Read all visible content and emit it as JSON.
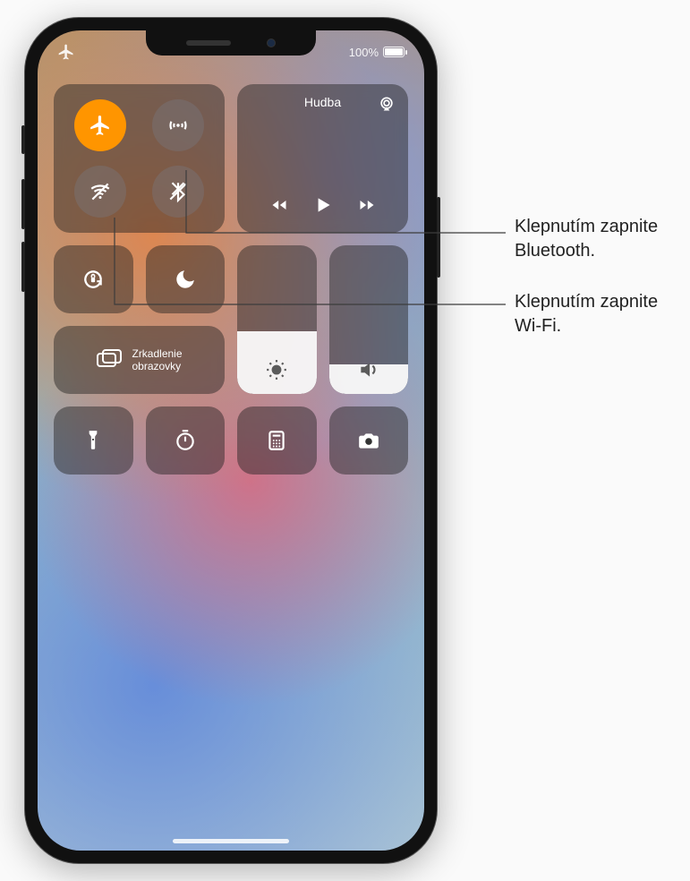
{
  "status": {
    "battery_pct": "100%"
  },
  "media": {
    "title": "Hudba"
  },
  "mirror": {
    "label": "Zrkadlenie obrazovky"
  },
  "sliders": {
    "brightness_pct": 42,
    "volume_pct": 20
  },
  "callouts": {
    "bluetooth": "Klepnutím zapnite Bluetooth.",
    "wifi": "Klepnutím zapnite Wi-Fi."
  },
  "icons": {
    "airplane": "airplane-icon",
    "cellular_antenna": "cellular-antenna-icon",
    "wifi_off": "wifi-off-icon",
    "bluetooth_off": "bluetooth-off-icon",
    "airplay": "airplay-icon",
    "back_track": "back-track-icon",
    "play": "play-icon",
    "forward_track": "forward-track-icon",
    "orientation_lock": "orientation-lock-icon",
    "dnd": "do-not-disturb-icon",
    "brightness": "brightness-icon",
    "volume": "volume-icon",
    "screen_mirror": "screen-mirror-icon",
    "flashlight": "flashlight-icon",
    "timer": "timer-icon",
    "calculator": "calculator-icon",
    "camera": "camera-icon"
  }
}
